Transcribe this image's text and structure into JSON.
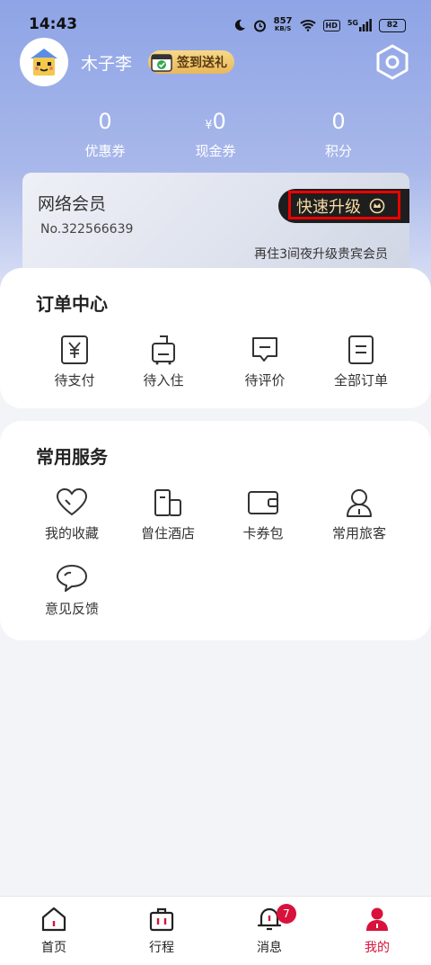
{
  "status_bar": {
    "time": "14:43",
    "net_speed": "857",
    "net_unit": "KB/S",
    "hd": "HD",
    "signal": "5G",
    "battery": "82"
  },
  "profile": {
    "name": "木子李",
    "signin_label": "签到送礼"
  },
  "stats": [
    {
      "value": "0",
      "prefix": "",
      "label": "优惠券"
    },
    {
      "value": "0",
      "prefix": "¥",
      "label": "现金券"
    },
    {
      "value": "0",
      "prefix": "",
      "label": "积分"
    }
  ],
  "member_card": {
    "title": "网络会员",
    "number": "No.322566639",
    "upgrade_label": "快速升级",
    "hint": "再住3间夜升级贵宾会员"
  },
  "orders": {
    "title": "订单中心",
    "items": [
      {
        "label": "待支付",
        "icon": "yen-card-icon"
      },
      {
        "label": "待入住",
        "icon": "luggage-icon"
      },
      {
        "label": "待评价",
        "icon": "comment-icon"
      },
      {
        "label": "全部订单",
        "icon": "order-list-icon"
      }
    ]
  },
  "services": {
    "title": "常用服务",
    "items": [
      {
        "label": "我的收藏",
        "icon": "heart-icon"
      },
      {
        "label": "曾住酒店",
        "icon": "building-icon"
      },
      {
        "label": "卡券包",
        "icon": "wallet-icon"
      },
      {
        "label": "常用旅客",
        "icon": "person-icon"
      },
      {
        "label": "意见反馈",
        "icon": "chat-bubble-icon"
      }
    ]
  },
  "tab_bar": {
    "items": [
      {
        "label": "首页",
        "icon": "home-icon"
      },
      {
        "label": "行程",
        "icon": "suitcase-icon"
      },
      {
        "label": "消息",
        "icon": "bell-icon",
        "badge": "7"
      },
      {
        "label": "我的",
        "icon": "profile-icon",
        "active": true
      }
    ]
  },
  "colors": {
    "accent": "#d8123b",
    "upgrade_bg": "#1e1e1e",
    "upgrade_text": "#f3d9a5",
    "header_gradient_top": "#8ea4e6"
  }
}
